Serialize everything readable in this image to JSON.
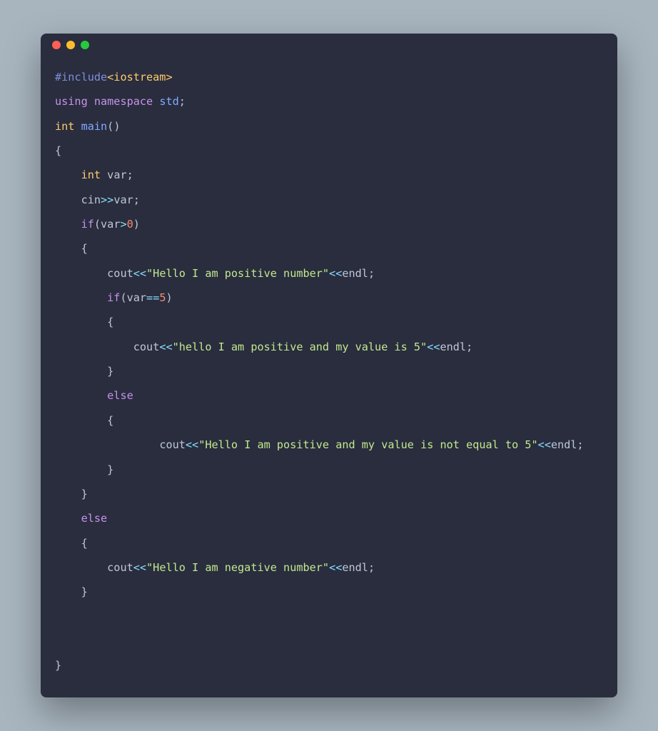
{
  "titlebar": {
    "close": "close",
    "minimize": "minimize",
    "zoom": "zoom"
  },
  "code": {
    "include_directive": "#include",
    "include_header": "<iostream>",
    "kw_using": "using",
    "kw_namespace": "namespace",
    "ns_std": "std",
    "semi": ";",
    "ty_int": "int",
    "fn_main": "main",
    "paren_open": "(",
    "paren_close": ")",
    "brace_open": "{",
    "brace_close": "}",
    "var_decl_var": "var",
    "id_cin": "cin",
    "op_rshift": ">>",
    "kw_if": "if",
    "op_gt": ">",
    "num_0": "0",
    "id_cout": "cout",
    "op_lshift": "<<",
    "str_pos": "\"Hello I am positive number\"",
    "id_endl": "endl",
    "op_eq": "==",
    "num_5": "5",
    "str_pos5": "\"hello I am positive and my value is 5\"",
    "kw_else": "else",
    "str_posnot5": "\"Hello I am positive and my value is not equal to 5\"",
    "str_neg": "\"Hello I am negative number\""
  }
}
